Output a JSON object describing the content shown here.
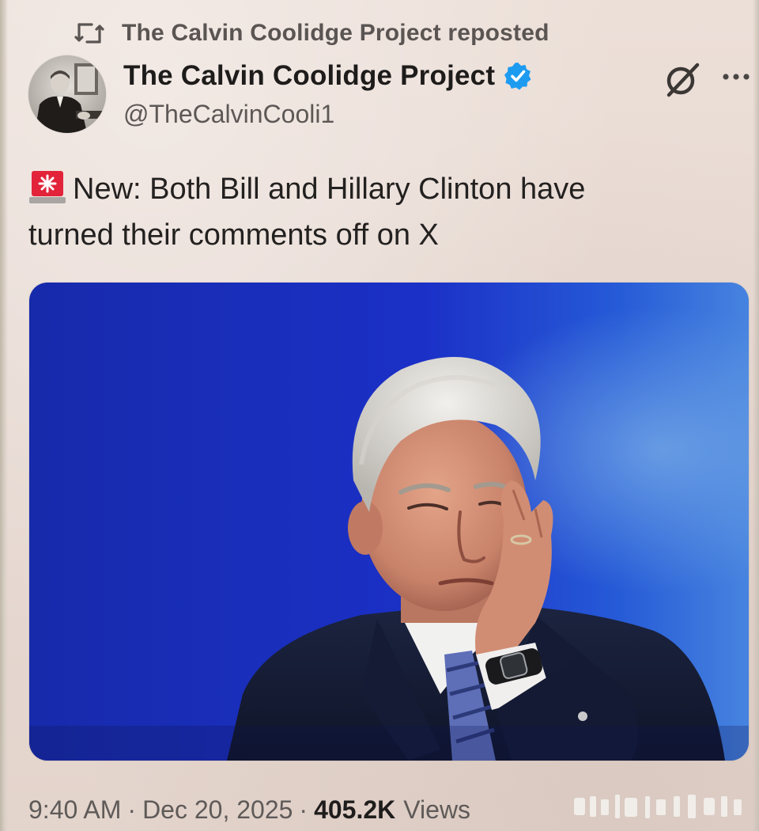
{
  "repost": {
    "label": "The Calvin Coolidge Project reposted",
    "icon": "repost-icon"
  },
  "author": {
    "display_name": "The Calvin Coolidge Project",
    "handle": "@TheCalvinCooli1",
    "verified": true,
    "verified_color": "#1d9bf0"
  },
  "tweet": {
    "emoji_icon": "police-siren-icon",
    "line1": "New: Both Bill and Hillary Clinton have",
    "line2": "turned their comments off on X"
  },
  "meta": {
    "time": "9:40 AM",
    "separator": "·",
    "date": "Dec 20, 2025",
    "views_count": "405.2K",
    "views_label": "Views"
  },
  "icons": {
    "grok": "grok-icon",
    "more": "more-options-icon"
  },
  "colors": {
    "background": "#e9ddd6",
    "text_primary": "#1e1c1b",
    "text_secondary": "#5d5856",
    "media_blue": "#1c2fd0"
  }
}
